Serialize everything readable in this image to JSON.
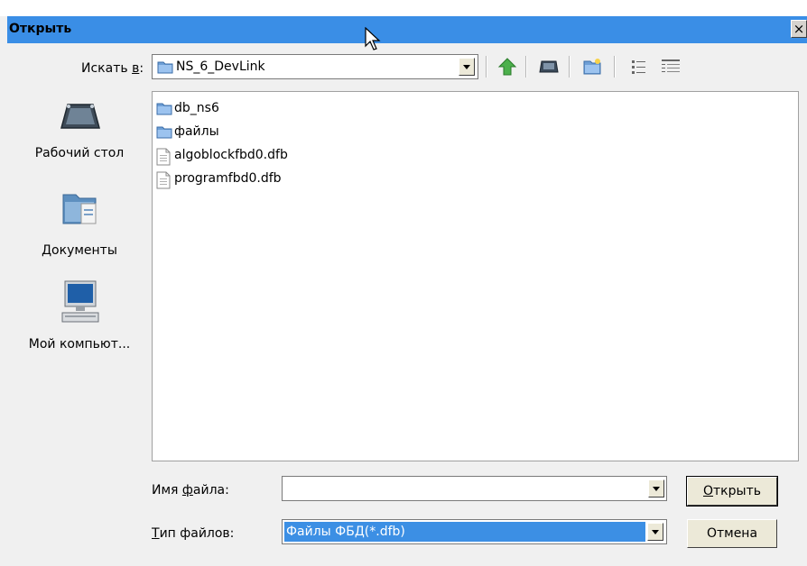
{
  "dialog": {
    "title": "Открыть",
    "close_glyph": "×"
  },
  "toolbar": {
    "lookin_label_pre": "Искать ",
    "lookin_label_u": "в",
    "lookin_label_post": ":",
    "lookin_value": "NS_6_DevLink",
    "buttons": [
      "up-one-level-icon",
      "desktop-icon",
      "new-folder-icon",
      "list-view-icon",
      "details-view-icon"
    ]
  },
  "places": [
    {
      "label": "Рабочий стол",
      "icon": "desktop-icon"
    },
    {
      "label": "Документы",
      "icon": "documents-icon"
    },
    {
      "label": "Мой компьют...",
      "icon": "computer-icon"
    }
  ],
  "files": [
    {
      "name": "db_ns6",
      "type": "folder"
    },
    {
      "name": "файлы",
      "type": "folder"
    },
    {
      "name": "algoblockfbd0.dfb",
      "type": "file"
    },
    {
      "name": "programfbd0.dfb",
      "type": "file"
    }
  ],
  "form": {
    "filename_label_pre": "Имя ",
    "filename_label_u": "ф",
    "filename_label_post": "айла:",
    "filename_value": "",
    "filetype_label_u": "Т",
    "filetype_label_post": "ип файлов:",
    "filetype_value": "Файлы ФБД(*.dfb)"
  },
  "buttons": {
    "open_u": "О",
    "open_rest": "ткрыть",
    "cancel": "Отмена"
  },
  "colors": {
    "titlebar": "#3a8ee6",
    "selection": "#3c8fe4"
  }
}
